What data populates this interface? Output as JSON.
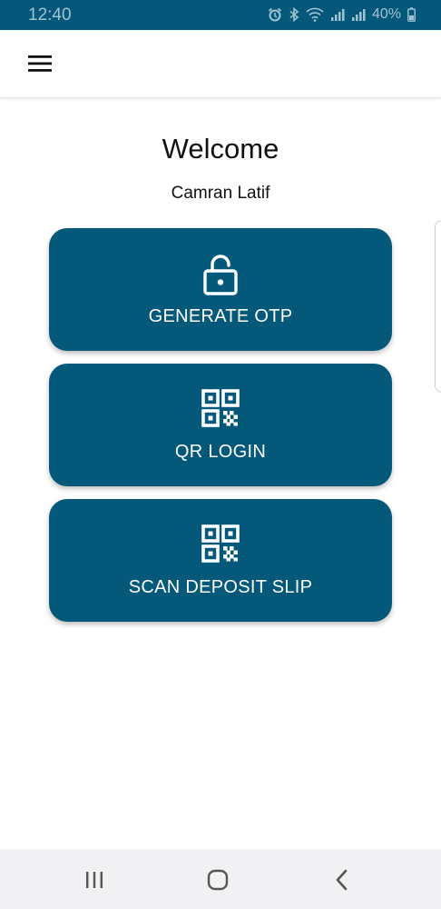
{
  "status_bar": {
    "time": "12:40",
    "battery": "40%",
    "icons": [
      "alarm-icon",
      "bluetooth-icon",
      "wifi-icon",
      "signal-icon",
      "signal-icon",
      "battery-icon"
    ]
  },
  "app_bar": {
    "menu_icon": "hamburger-menu-icon"
  },
  "main": {
    "welcome": "Welcome",
    "user_name": "Camran Latif",
    "actions": [
      {
        "label": "GENERATE OTP",
        "icon": "lock-icon"
      },
      {
        "label": "QR LOGIN",
        "icon": "qr-code-icon"
      },
      {
        "label": "SCAN DEPOSIT SLIP",
        "icon": "qr-code-icon"
      }
    ]
  },
  "nav_bar": {
    "buttons": [
      "recent-apps-icon",
      "home-icon",
      "back-icon"
    ]
  },
  "colors": {
    "status_bar": "#06587a",
    "card": "#04597b",
    "card_text": "#ffffff",
    "nav_bar": "#f1f0f3"
  }
}
